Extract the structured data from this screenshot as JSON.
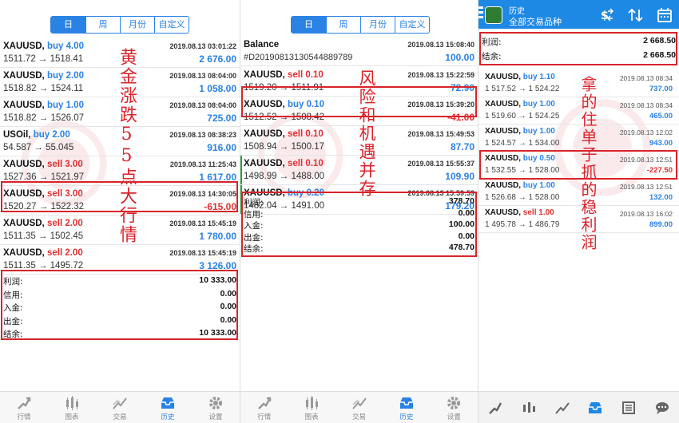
{
  "tabs": [
    "日",
    "周",
    "月份",
    "自定义"
  ],
  "nav": [
    "行情",
    "图表",
    "交易",
    "历史",
    "设置"
  ],
  "panel1": {
    "rows": [
      {
        "symbol": "XAUUSD,",
        "side": "buy",
        "vol": "4.00",
        "date": "2019.08.13 03:01:22",
        "price": "1511.72 → 1518.41",
        "pnl": "2 676.00"
      },
      {
        "symbol": "XAUUSD,",
        "side": "buy",
        "vol": "2.00",
        "date": "2019.08.13 08:04:00",
        "price": "1518.82 → 1524.11",
        "pnl": "1 058.00"
      },
      {
        "symbol": "XAUUSD,",
        "side": "buy",
        "vol": "1.00",
        "date": "2019.08.13 08:04:00",
        "price": "1518.82 → 1526.07",
        "pnl": "725.00"
      },
      {
        "symbol": "USOil,",
        "side": "buy",
        "vol": "2.00",
        "date": "2019.08.13 08:38:23",
        "price": "54.587 → 55.045",
        "pnl": "916.00"
      },
      {
        "symbol": "XAUUSD,",
        "side": "sell",
        "vol": "3.00",
        "date": "2019.08.13 11:25:43",
        "price": "1527.36 → 1521.97",
        "pnl": "1 617.00"
      },
      {
        "symbol": "XAUUSD,",
        "side": "sell",
        "vol": "3.00",
        "date": "2019.08.13 14:30:05",
        "price": "1520.27 → 1522.32",
        "pnl": "-615.00"
      },
      {
        "symbol": "XAUUSD,",
        "side": "sell",
        "vol": "2.00",
        "date": "2019.08.13 15:45:19",
        "price": "1511.35 → 1502.45",
        "pnl": "1 780.00"
      },
      {
        "symbol": "XAUUSD,",
        "side": "sell",
        "vol": "2.00",
        "date": "2019.08.13 15:45:19",
        "price": "1511.35 → 1495.72",
        "pnl": "3 126.00"
      }
    ],
    "summary": [
      {
        "k": "利润:",
        "v": "10 333.00"
      },
      {
        "k": "信用:",
        "v": "0.00"
      },
      {
        "k": "入金:",
        "v": "0.00"
      },
      {
        "k": "出金:",
        "v": "0.00"
      },
      {
        "k": "结余:",
        "v": "10 333.00"
      }
    ],
    "caption": "黄金涨跌55点大行情"
  },
  "panel2": {
    "balance_row": {
      "symbol": "Balance",
      "date": "2019.08.13 15:08:40",
      "ref": "#D20190813130544889789",
      "pnl": "100.00"
    },
    "rows": [
      {
        "symbol": "XAUUSD,",
        "side": "sell",
        "vol": "0.10",
        "date": "2019.08.13 15:22:59",
        "price": "1519.20 → 1511.91",
        "pnl": "72.90"
      },
      {
        "symbol": "XAUUSD,",
        "side": "buy",
        "vol": "0.10",
        "date": "2019.08.13 15:39:20",
        "price": "1512.52 → 1508.42",
        "pnl": "-41.00"
      },
      {
        "symbol": "XAUUSD,",
        "side": "sell",
        "vol": "0.10",
        "date": "2019.08.13 15:49:53",
        "price": "1508.94 → 1500.17",
        "pnl": "87.70"
      },
      {
        "symbol": "XAUUSD,",
        "side": "sell",
        "vol": "0.10",
        "date": "2019.08.13 15:55:37",
        "price": "1498.99 → 1488.00",
        "pnl": "109.90"
      },
      {
        "symbol": "XAUUSD,",
        "side": "buy",
        "vol": "0.20",
        "date": "2019.08.13 15:59:59",
        "price": "1482.04 → 1491.00",
        "pnl": "179.20"
      }
    ],
    "summary": [
      {
        "k": "利润:",
        "v": "378.70"
      },
      {
        "k": "信用:",
        "v": "0.00"
      },
      {
        "k": "入金:",
        "v": "100.00"
      },
      {
        "k": "出金:",
        "v": "0.00"
      },
      {
        "k": "结余:",
        "v": "478.70"
      }
    ],
    "caption": "风险和机遇并存"
  },
  "panel3": {
    "header_title": "历史",
    "header_subtitle": "全部交易品种",
    "summary": [
      {
        "k": "利润:",
        "v": "2 668.50"
      },
      {
        "k": "结余:",
        "v": "2 668.50"
      }
    ],
    "rows": [
      {
        "symbol": "XAUUSD,",
        "side": "buy",
        "vol": "1.10",
        "date": "2019.08.13 08:34",
        "price": "1 517.52 → 1 524.22",
        "pnl": "737.00"
      },
      {
        "symbol": "XAUUSD,",
        "side": "buy",
        "vol": "1.00",
        "date": "2019.08.13 08:34",
        "price": "1 519.60 → 1 524.25",
        "pnl": "465.00"
      },
      {
        "symbol": "XAUUSD,",
        "side": "buy",
        "vol": "1.00",
        "date": "2019.08.13 12:02",
        "price": "1 524.57 → 1 534.00",
        "pnl": "943.00"
      },
      {
        "symbol": "XAUUSD,",
        "side": "buy",
        "vol": "0.50",
        "date": "2019.08.13 12:51",
        "price": "1 532.55 → 1 528.00",
        "pnl": "-227.50"
      },
      {
        "symbol": "XAUUSD,",
        "side": "buy",
        "vol": "1.00",
        "date": "2019.08.13 12:51",
        "price": "1 526.68 → 1 528.00",
        "pnl": "132.00"
      },
      {
        "symbol": "XAUUSD,",
        "side": "sell",
        "vol": "1.00",
        "date": "2019.08.13 16:02",
        "price": "1 495.78 → 1 486.79",
        "pnl": "899.00"
      }
    ],
    "caption": "拿的住单子抓的稳利润"
  },
  "colors": {
    "accent": "#2a82e4",
    "loss": "#e03030",
    "highlight": "#d9232a",
    "header": "#1e88e5"
  },
  "icons": {
    "nav": [
      "quotes-icon",
      "chart-icon",
      "trade-icon",
      "history-icon",
      "settings-icon"
    ],
    "panel3_header": [
      "menu-icon",
      "currency-icon",
      "sort-icon",
      "calendar-icon"
    ],
    "panel3_nav": [
      "quotes-icon",
      "chart-icon",
      "trade-icon",
      "history-icon",
      "news-icon",
      "chat-icon"
    ]
  }
}
